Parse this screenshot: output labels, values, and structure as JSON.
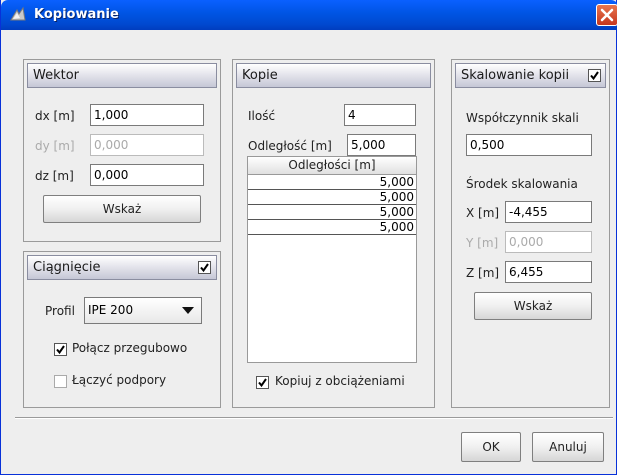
{
  "window": {
    "title": "Kopiowanie"
  },
  "wektor": {
    "header": "Wektor",
    "dx_label": "dx [m]",
    "dx_value": "1,000",
    "dy_label": "dy [m]",
    "dy_value": "0,000",
    "dz_label": "dz [m]",
    "dz_value": "0,000",
    "button": "Wskaż"
  },
  "ciagniecie": {
    "header": "Ciągnięcie",
    "header_checked": true,
    "profil_label": "Profil",
    "profil_value": "IPE 200",
    "polacz_label": "Połącz przegubowo",
    "polacz_checked": true,
    "laczyc_label": "Łączyć podpory",
    "laczyc_checked": false
  },
  "kopie": {
    "header": "Kopie",
    "ilosc_label": "Ilość",
    "ilosc_value": "4",
    "odleglosc_label": "Odległość [m]",
    "odleglosc_value": "5,000",
    "table_header": "Odległości [m]",
    "table_rows": [
      "5,000",
      "5,000",
      "5,000",
      "5,000"
    ],
    "kopiuj_label": "Kopiuj z obciążeniami",
    "kopiuj_checked": true
  },
  "skalowanie": {
    "header": "Skalowanie kopii",
    "header_checked": true,
    "wspolczynnik_label": "Współczynnik skali",
    "wspolczynnik_value": "0,500",
    "srodek_label": "Środek skalowania",
    "x_label": "X [m]",
    "x_value": "-4,455",
    "y_label": "Y [m]",
    "y_value": "0,000",
    "z_label": "Z [m]",
    "z_value": "6,455",
    "button": "Wskaż"
  },
  "footer": {
    "ok": "OK",
    "cancel": "Anuluj"
  }
}
